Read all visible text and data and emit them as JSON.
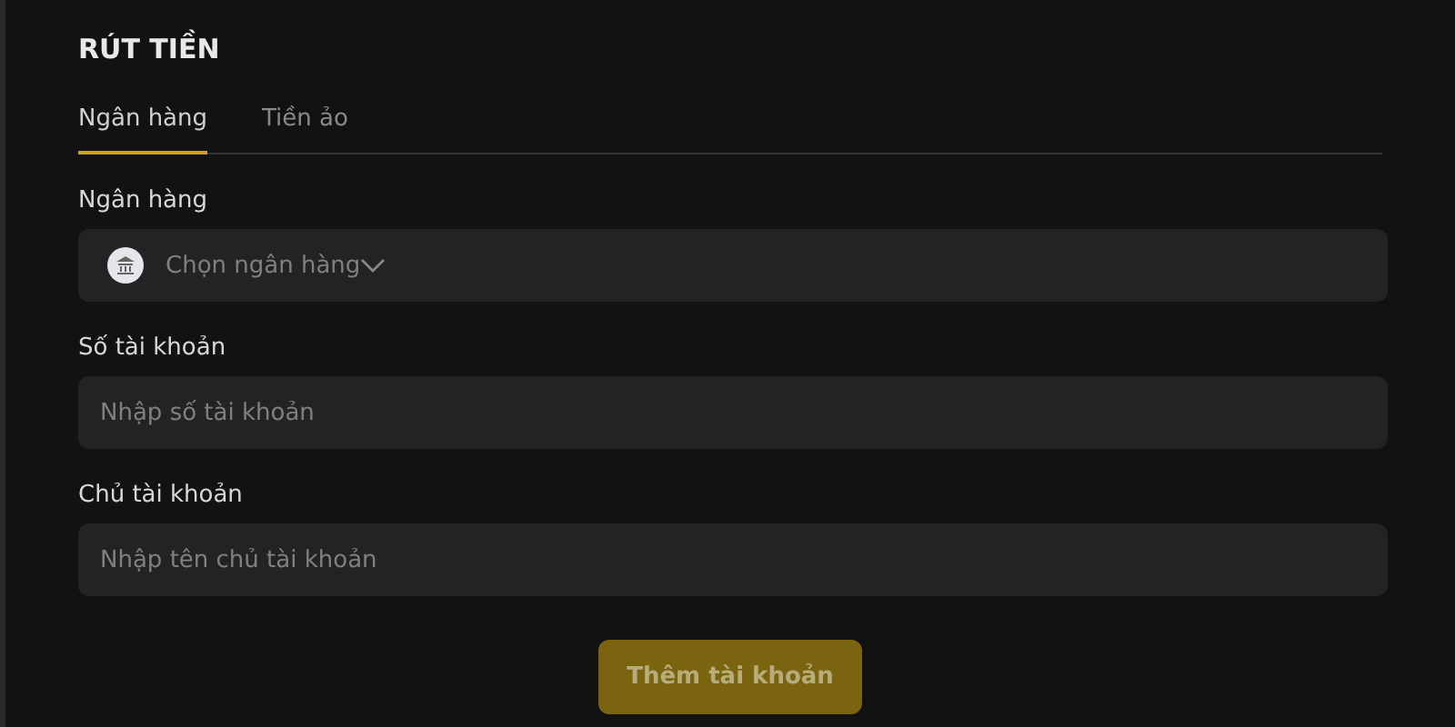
{
  "title": "RÚT TIỀN",
  "tabs": [
    {
      "label": "Ngân hàng",
      "selected": true
    },
    {
      "label": "Tiền ảo",
      "selected": false
    }
  ],
  "fields": [
    {
      "kind": "select",
      "label": "Ngân hàng",
      "placeholder": "Chọn ngân hàng"
    },
    {
      "kind": "text",
      "label": "Số tài khoản",
      "placeholder": "Nhập số tài khoản"
    },
    {
      "kind": "text",
      "label": "Chủ tài khoản",
      "placeholder": "Nhập tên chủ tài khoản"
    }
  ],
  "submit": {
    "label": "Thêm tài khoản",
    "disabled": true
  }
}
